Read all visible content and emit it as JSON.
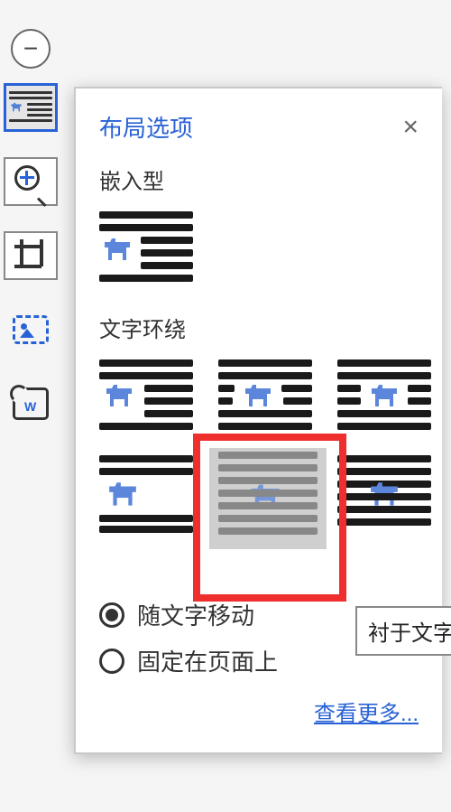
{
  "panel": {
    "title": "布局选项",
    "section_inline": "嵌入型",
    "section_wrap": "文字环绕",
    "tooltip": "衬于文字下",
    "radio_move": "随文字移动",
    "radio_fixed": "固定在页面上",
    "see_more": "查看更多...",
    "close": "×"
  },
  "toolbar": {
    "collapse": "−"
  }
}
